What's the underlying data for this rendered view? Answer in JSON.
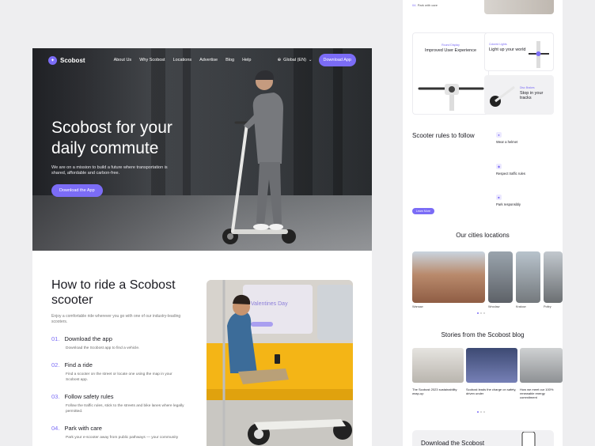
{
  "nav": {
    "logo": "Scobost",
    "items": [
      "About Us",
      "Why Scobost",
      "Locations",
      "Advertise",
      "Blog",
      "Help"
    ],
    "language": "Global (EN)",
    "cta": "Download App"
  },
  "hero": {
    "title": "Scobost for your daily commute",
    "subtitle": "We are on a mission to build a future where transportation is shared, affordable and carbon-free.",
    "cta": "Download the App"
  },
  "ride": {
    "title": "How to ride a Scobost scooter",
    "subtitle": "Enjoy a comfortable ride wherever you go with one of our industry-leading scooters.",
    "steps": [
      {
        "num": "01.",
        "title": "Download the app",
        "desc": "Download the Scobost app to find a vehicle."
      },
      {
        "num": "02.",
        "title": "Find a ride",
        "desc": "Find a scooter on the street or locate one using the map in your Scobost app."
      },
      {
        "num": "03.",
        "title": "Follow safety rules",
        "desc": "Follow the traffic rules, stick to the streets and bike lanes where legally permitted."
      },
      {
        "num": "04.",
        "title": "Park with care",
        "desc": "Park your e-scooter away from public pathways — your community"
      }
    ],
    "photo_sign": "Valentines Day"
  },
  "right": {
    "top_step": {
      "num": "04.",
      "title": "Park with care"
    },
    "features": [
      {
        "kicker": "Round Display",
        "title": "Improved User Experience"
      },
      {
        "kicker": "Colored Lights",
        "title": "Light up your world"
      },
      {
        "kicker": "Disc Brakes",
        "title": "Stop in your tracks"
      }
    ],
    "rules_title": "Scooter rules to follow",
    "rules": [
      {
        "title": "Wear a helmet"
      },
      {
        "title": "Respect traffic rules"
      },
      {
        "title": "Park responsibly"
      }
    ],
    "learn_more": "Learn More",
    "cities_title": "Our cities locations",
    "cities": [
      "Warsaw",
      "Wroclaw",
      "Krakow",
      "Poltry"
    ],
    "blog_title": "Stories from the Scobost blog",
    "posts": [
      {
        "title": "The Scobost 2023 sustainability wrap-up"
      },
      {
        "title": "Scobost leads the charge on safety, driven under"
      },
      {
        "title": "How we meet our 100% renewable energy commitment"
      }
    ],
    "download_title": "Download the Scobost"
  },
  "colors": {
    "accent": "#7b6cf6",
    "background": "#eeeef0"
  }
}
